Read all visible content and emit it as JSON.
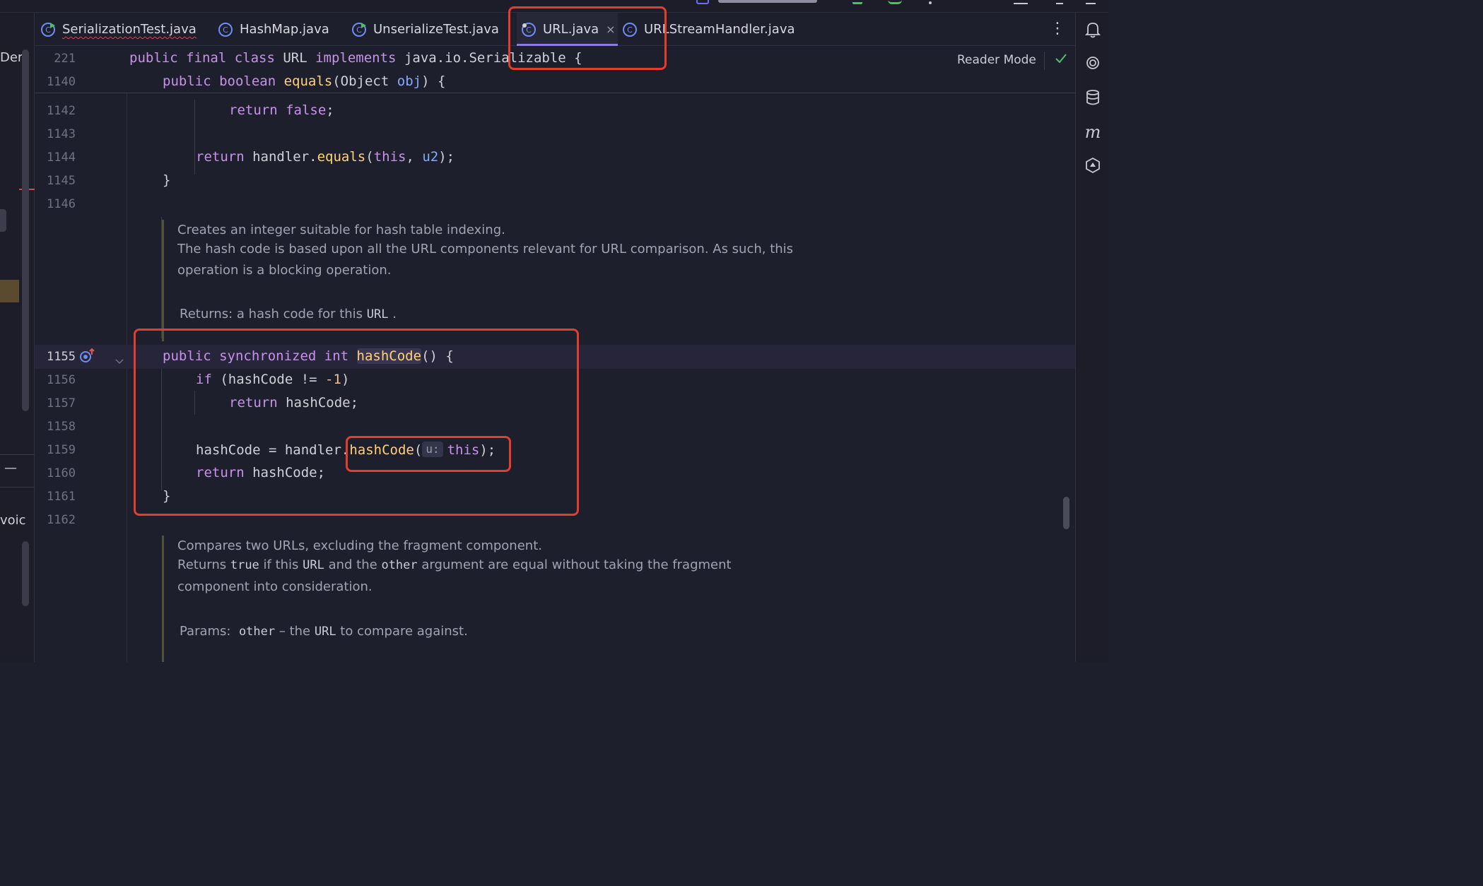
{
  "colors": {
    "accent": "#8f78e0",
    "annotation_red": "#e33e2b",
    "keyword": "#c792ea",
    "function": "#ffd27a",
    "param": "#82aaff"
  },
  "left_panel": {
    "fragment_top": "Der",
    "fragment_mid": "—",
    "fragment_bottom": "voic"
  },
  "tabs": [
    {
      "label": "SerializationTest.java",
      "icon": "class-run-icon",
      "active": false,
      "error": true
    },
    {
      "label": "HashMap.java",
      "icon": "class-icon",
      "active": false
    },
    {
      "label": "UnserializeTest.java",
      "icon": "class-run-icon",
      "active": false
    },
    {
      "label": "URL.java",
      "icon": "class-icon",
      "active": true,
      "close": "×"
    },
    {
      "label": "URLStreamHandler.java",
      "icon": "class-icon",
      "active": false
    }
  ],
  "tab_more": "⋮",
  "sticky": {
    "line1_no": "221",
    "line1": {
      "kw": "public final class ",
      "name": "URL ",
      "kw2": "implements ",
      "rest": "java.io.Serializable {"
    },
    "line2_no": "1140",
    "line2": {
      "kw": "public boolean ",
      "fn": "equals",
      "rest1": "(Object ",
      "prm": "obj",
      "rest2": ") {"
    },
    "reader_mode": "Reader Mode"
  },
  "lines": {
    "l1142": {
      "no": "1142",
      "kw": "return ",
      "kw2": "false",
      "rest": ";"
    },
    "l1143": {
      "no": "1143"
    },
    "l1144": {
      "no": "1144",
      "kw": "return ",
      "a": "handler.",
      "fn": "equals",
      "b": "(",
      "kw2": "this",
      "c": ", ",
      "prm": "u2",
      "d": ");"
    },
    "l1145": {
      "no": "1145",
      "text": "}"
    },
    "l1146": {
      "no": "1146"
    },
    "l1155": {
      "no": "1155",
      "kw": "public synchronized int ",
      "fn": "hashCode",
      "rest": "() {"
    },
    "l1156": {
      "no": "1156",
      "kw": "if ",
      "rest": "(hashCode != ",
      "num": "-1",
      "rest2": ")"
    },
    "l1157": {
      "no": "1157",
      "kw": "return ",
      "rest": "hashCode;"
    },
    "l1158": {
      "no": "1158"
    },
    "l1159": {
      "no": "1159",
      "a": "hashCode = handler.",
      "fn": "hashCode",
      "b": "(",
      "hint": "u:",
      "kw": "this",
      "c": ");"
    },
    "l1160": {
      "no": "1160",
      "kw": "return ",
      "rest": "hashCode;"
    },
    "l1161": {
      "no": "1161",
      "text": "}"
    },
    "l1162": {
      "no": "1162"
    }
  },
  "doc1": {
    "line1": "Creates an integer suitable for hash table indexing.",
    "line2": "The hash code is based upon all the URL components relevant for URL comparison. As such, this",
    "line3": "operation is a blocking operation.",
    "returns_label": "Returns:",
    "returns_text": " a hash code for this ",
    "returns_code": "URL",
    "returns_end": " ."
  },
  "doc2": {
    "line1": "Compares two URLs, excluding the fragment component.",
    "l2_a": "Returns ",
    "l2_code1": "true",
    "l2_b": " if this ",
    "l2_code2": "URL",
    "l2_c": " and the ",
    "l2_code3": "other",
    "l2_d": " argument are equal without taking the fragment",
    "line3": "component into consideration.",
    "params_label": "Params:",
    "params_code": "other",
    "params_text": " – the ",
    "params_code2": "URL",
    "params_end": " to compare against."
  }
}
